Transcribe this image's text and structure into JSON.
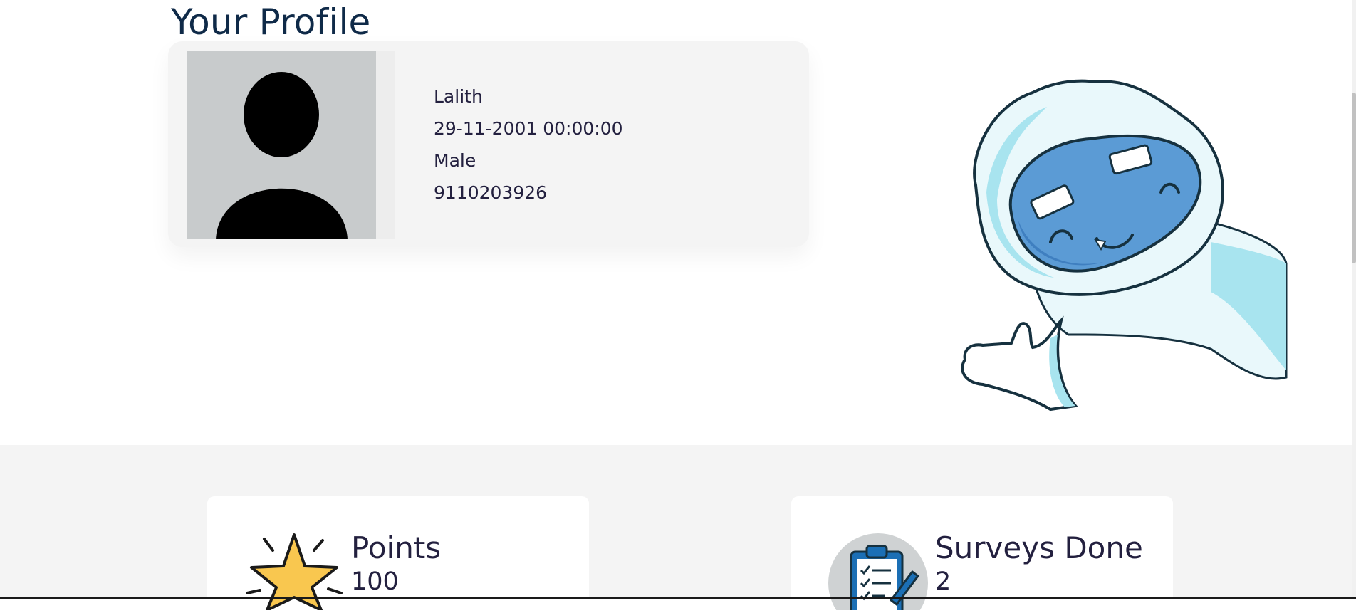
{
  "page": {
    "title": "Your Profile"
  },
  "profile": {
    "name": "Lalith",
    "dob": "29-11-2001 00:00:00",
    "gender": "Male",
    "phone": "9110203926",
    "avatar_icon": "person-silhouette-icon"
  },
  "mascot": {
    "icon": "yeti-mascot-illustration"
  },
  "stats": {
    "points": {
      "label": "Points",
      "value": "100",
      "icon": "star-icon"
    },
    "surveys": {
      "label": "Surveys Done",
      "value": "2",
      "icon": "clipboard-checklist-icon"
    }
  },
  "colors": {
    "title": "#0f2a48",
    "card_bg": "#f4f4f4",
    "avatar_bg": "#c8cbcc",
    "star": "#f9c74f",
    "yeti_face": "#5b9bd5",
    "yeti_fur": "#a8e4ef"
  }
}
